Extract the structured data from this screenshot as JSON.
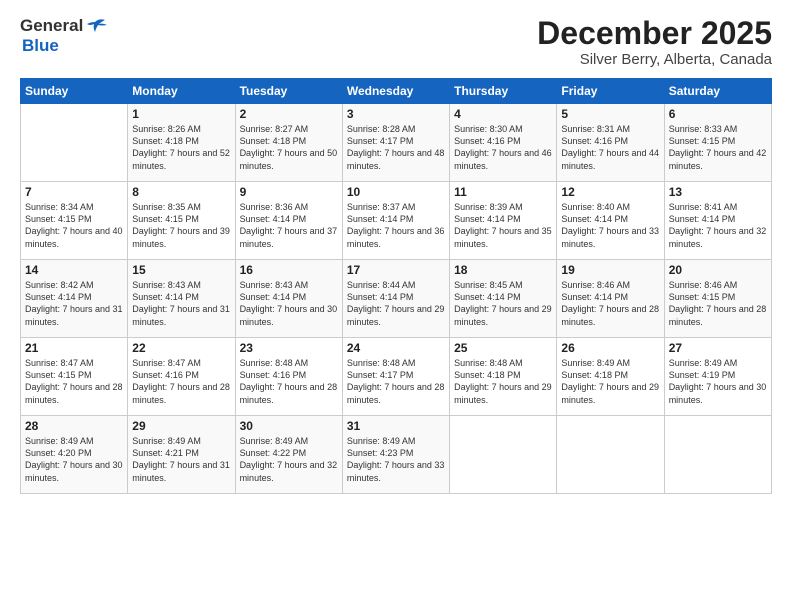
{
  "header": {
    "logo_general": "General",
    "logo_blue": "Blue",
    "month_title": "December 2025",
    "location": "Silver Berry, Alberta, Canada"
  },
  "weekdays": [
    "Sunday",
    "Monday",
    "Tuesday",
    "Wednesday",
    "Thursday",
    "Friday",
    "Saturday"
  ],
  "weeks": [
    [
      {
        "day": "",
        "sunrise": "",
        "sunset": "",
        "daylight": ""
      },
      {
        "day": "1",
        "sunrise": "Sunrise: 8:26 AM",
        "sunset": "Sunset: 4:18 PM",
        "daylight": "Daylight: 7 hours and 52 minutes."
      },
      {
        "day": "2",
        "sunrise": "Sunrise: 8:27 AM",
        "sunset": "Sunset: 4:18 PM",
        "daylight": "Daylight: 7 hours and 50 minutes."
      },
      {
        "day": "3",
        "sunrise": "Sunrise: 8:28 AM",
        "sunset": "Sunset: 4:17 PM",
        "daylight": "Daylight: 7 hours and 48 minutes."
      },
      {
        "day": "4",
        "sunrise": "Sunrise: 8:30 AM",
        "sunset": "Sunset: 4:16 PM",
        "daylight": "Daylight: 7 hours and 46 minutes."
      },
      {
        "day": "5",
        "sunrise": "Sunrise: 8:31 AM",
        "sunset": "Sunset: 4:16 PM",
        "daylight": "Daylight: 7 hours and 44 minutes."
      },
      {
        "day": "6",
        "sunrise": "Sunrise: 8:33 AM",
        "sunset": "Sunset: 4:15 PM",
        "daylight": "Daylight: 7 hours and 42 minutes."
      }
    ],
    [
      {
        "day": "7",
        "sunrise": "Sunrise: 8:34 AM",
        "sunset": "Sunset: 4:15 PM",
        "daylight": "Daylight: 7 hours and 40 minutes."
      },
      {
        "day": "8",
        "sunrise": "Sunrise: 8:35 AM",
        "sunset": "Sunset: 4:15 PM",
        "daylight": "Daylight: 7 hours and 39 minutes."
      },
      {
        "day": "9",
        "sunrise": "Sunrise: 8:36 AM",
        "sunset": "Sunset: 4:14 PM",
        "daylight": "Daylight: 7 hours and 37 minutes."
      },
      {
        "day": "10",
        "sunrise": "Sunrise: 8:37 AM",
        "sunset": "Sunset: 4:14 PM",
        "daylight": "Daylight: 7 hours and 36 minutes."
      },
      {
        "day": "11",
        "sunrise": "Sunrise: 8:39 AM",
        "sunset": "Sunset: 4:14 PM",
        "daylight": "Daylight: 7 hours and 35 minutes."
      },
      {
        "day": "12",
        "sunrise": "Sunrise: 8:40 AM",
        "sunset": "Sunset: 4:14 PM",
        "daylight": "Daylight: 7 hours and 33 minutes."
      },
      {
        "day": "13",
        "sunrise": "Sunrise: 8:41 AM",
        "sunset": "Sunset: 4:14 PM",
        "daylight": "Daylight: 7 hours and 32 minutes."
      }
    ],
    [
      {
        "day": "14",
        "sunrise": "Sunrise: 8:42 AM",
        "sunset": "Sunset: 4:14 PM",
        "daylight": "Daylight: 7 hours and 31 minutes."
      },
      {
        "day": "15",
        "sunrise": "Sunrise: 8:43 AM",
        "sunset": "Sunset: 4:14 PM",
        "daylight": "Daylight: 7 hours and 31 minutes."
      },
      {
        "day": "16",
        "sunrise": "Sunrise: 8:43 AM",
        "sunset": "Sunset: 4:14 PM",
        "daylight": "Daylight: 7 hours and 30 minutes."
      },
      {
        "day": "17",
        "sunrise": "Sunrise: 8:44 AM",
        "sunset": "Sunset: 4:14 PM",
        "daylight": "Daylight: 7 hours and 29 minutes."
      },
      {
        "day": "18",
        "sunrise": "Sunrise: 8:45 AM",
        "sunset": "Sunset: 4:14 PM",
        "daylight": "Daylight: 7 hours and 29 minutes."
      },
      {
        "day": "19",
        "sunrise": "Sunrise: 8:46 AM",
        "sunset": "Sunset: 4:14 PM",
        "daylight": "Daylight: 7 hours and 28 minutes."
      },
      {
        "day": "20",
        "sunrise": "Sunrise: 8:46 AM",
        "sunset": "Sunset: 4:15 PM",
        "daylight": "Daylight: 7 hours and 28 minutes."
      }
    ],
    [
      {
        "day": "21",
        "sunrise": "Sunrise: 8:47 AM",
        "sunset": "Sunset: 4:15 PM",
        "daylight": "Daylight: 7 hours and 28 minutes."
      },
      {
        "day": "22",
        "sunrise": "Sunrise: 8:47 AM",
        "sunset": "Sunset: 4:16 PM",
        "daylight": "Daylight: 7 hours and 28 minutes."
      },
      {
        "day": "23",
        "sunrise": "Sunrise: 8:48 AM",
        "sunset": "Sunset: 4:16 PM",
        "daylight": "Daylight: 7 hours and 28 minutes."
      },
      {
        "day": "24",
        "sunrise": "Sunrise: 8:48 AM",
        "sunset": "Sunset: 4:17 PM",
        "daylight": "Daylight: 7 hours and 28 minutes."
      },
      {
        "day": "25",
        "sunrise": "Sunrise: 8:48 AM",
        "sunset": "Sunset: 4:18 PM",
        "daylight": "Daylight: 7 hours and 29 minutes."
      },
      {
        "day": "26",
        "sunrise": "Sunrise: 8:49 AM",
        "sunset": "Sunset: 4:18 PM",
        "daylight": "Daylight: 7 hours and 29 minutes."
      },
      {
        "day": "27",
        "sunrise": "Sunrise: 8:49 AM",
        "sunset": "Sunset: 4:19 PM",
        "daylight": "Daylight: 7 hours and 30 minutes."
      }
    ],
    [
      {
        "day": "28",
        "sunrise": "Sunrise: 8:49 AM",
        "sunset": "Sunset: 4:20 PM",
        "daylight": "Daylight: 7 hours and 30 minutes."
      },
      {
        "day": "29",
        "sunrise": "Sunrise: 8:49 AM",
        "sunset": "Sunset: 4:21 PM",
        "daylight": "Daylight: 7 hours and 31 minutes."
      },
      {
        "day": "30",
        "sunrise": "Sunrise: 8:49 AM",
        "sunset": "Sunset: 4:22 PM",
        "daylight": "Daylight: 7 hours and 32 minutes."
      },
      {
        "day": "31",
        "sunrise": "Sunrise: 8:49 AM",
        "sunset": "Sunset: 4:23 PM",
        "daylight": "Daylight: 7 hours and 33 minutes."
      },
      {
        "day": "",
        "sunrise": "",
        "sunset": "",
        "daylight": ""
      },
      {
        "day": "",
        "sunrise": "",
        "sunset": "",
        "daylight": ""
      },
      {
        "day": "",
        "sunrise": "",
        "sunset": "",
        "daylight": ""
      }
    ]
  ]
}
